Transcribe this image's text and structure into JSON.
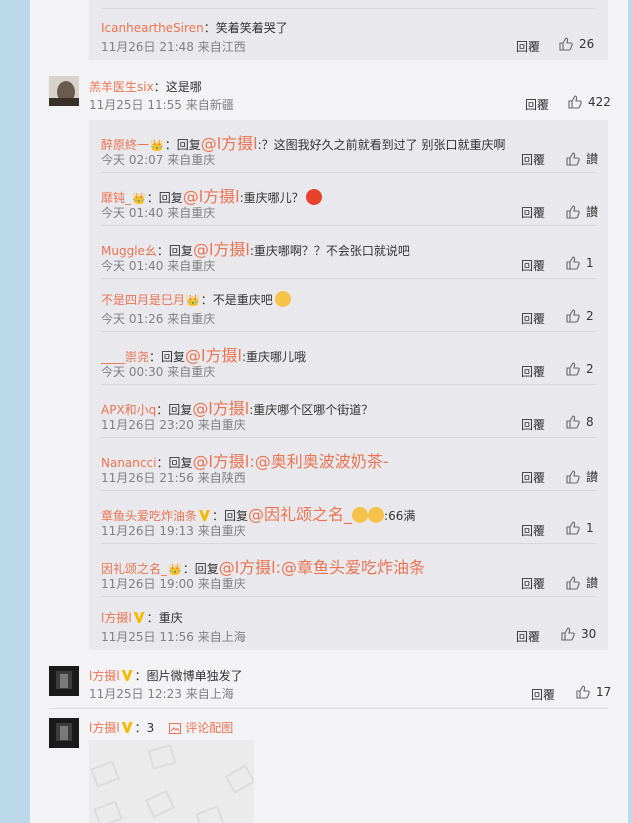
{
  "top_reply": {
    "name": "IcanheartheSiren",
    "text": "：笑着笑着哭了",
    "time": "11月26日 21:48 来自江西",
    "reply": "回覆",
    "likes": "26"
  },
  "c1": {
    "name": "羔羊医生six",
    "text": "：这是哪",
    "time": "11月25日 11:55 来自新疆",
    "reply": "回覆",
    "likes": "422"
  },
  "subs": [
    {
      "name": "醉原終一",
      "prefix": "：回复",
      "mention": "@l方摄l",
      "text": ":？这图我好久之前就看到过了 别张口就重庆啊",
      "time": "今天 02:07 来自重庆",
      "reply": "回覆",
      "likes": "讃"
    },
    {
      "name": "靡钝_",
      "prefix": "：回复",
      "mention": "@l方摄l",
      "text": ":重庆哪儿？",
      "time": "今天 01:40 来自重庆",
      "reply": "回覆",
      "likes": "讃"
    },
    {
      "name": "Muggle幺",
      "prefix": "：回复",
      "mention": "@l方摄l",
      "text": ":重庆哪啊？？不会张口就说吧",
      "time": "今天 01:40 来自重庆",
      "reply": "回覆",
      "likes": "1"
    },
    {
      "name": "不是四月是巳月",
      "prefix": "：",
      "mention": "",
      "text": "不是重庆吧",
      "time": "今天 01:26 来自重庆",
      "reply": "回覆",
      "likes": "2"
    },
    {
      "name": "____崇尧",
      "prefix": "：回复",
      "mention": "@l方摄l",
      "text": ":重庆哪儿哦",
      "time": "今天 00:30 来自重庆",
      "reply": "回覆",
      "likes": "2"
    },
    {
      "name": "APX和小q",
      "prefix": "：回复",
      "mention": "@l方摄l",
      "text": ":重庆哪个区哪个街道？",
      "time": "11月26日 23:20 来自重庆",
      "reply": "回覆",
      "likes": "8"
    },
    {
      "name": "Nanancci",
      "prefix": "：回复",
      "mention": "@l方摄l",
      "text": ":@奥利奥波波奶茶-",
      "time": "11月26日 21:56 来自陕西",
      "reply": "回覆",
      "likes": "讃"
    },
    {
      "name": "章鱼头爱吃炸油条",
      "prefix": "：回复",
      "mention": "@因礼颂之名_",
      "text": ":66满",
      "time": "11月26日 19:13 来自重庆",
      "reply": "回覆",
      "likes": "1"
    },
    {
      "name": "因礼颂之名_",
      "prefix": "：回复",
      "mention": "@l方摄l",
      "text": ":@章鱼头爱吃炸油条",
      "time": "11月26日 19:00 来自重庆",
      "reply": "回覆",
      "likes": "讃"
    },
    {
      "name": "l方摄l",
      "prefix": "：",
      "mention": "",
      "text": "重庆",
      "time": "11月25日 11:56 来自上海",
      "reply": "回覆",
      "likes": "30"
    }
  ],
  "c2": {
    "name": "l方摄l",
    "text": "：图片微博单独发了",
    "time": "11月25日 12:23 来自上海",
    "reply": "回覆",
    "likes": "17"
  },
  "c3": {
    "name": "l方摄l",
    "text": "：3",
    "pic_label": "评论配图"
  },
  "colors": {
    "name": "#eb7350",
    "panel": "#f3f3f5",
    "subpanel": "#e9e9ed"
  }
}
